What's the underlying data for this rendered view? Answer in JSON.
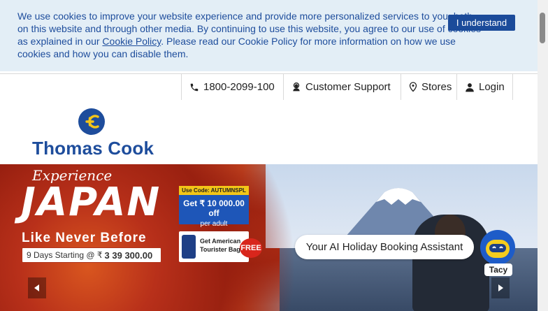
{
  "cookie_banner": {
    "text_before": "We use cookies to improve your website experience and provide more personalized services to you, both on this website and through other media. By continuing to use this website, you agree to our use of cookies as explained in our ",
    "policy_link": "Cookie Policy",
    "text_after": ". Please read our Cookie Policy for more information on how we use cookies and how you can disable them.",
    "button_label": "I understand"
  },
  "topbar": {
    "phone": "1800-2099-100",
    "support": "Customer Support",
    "stores": "Stores",
    "login": "Login"
  },
  "brand": {
    "name": "Thomas Cook",
    "logo_color": "#1e4d9c"
  },
  "hero": {
    "kicker": "Experience",
    "title": "JAPAN",
    "tagline": "Like Never Before",
    "days_text": "9 Days Starting @ ₹",
    "price": "3 39 300.00",
    "promo_code_label": "Use Code: AUTUMNSPL",
    "offer_line1": "Get ₹ 10 000.00 off",
    "offer_line2": "per adult",
    "bag_line1": "Get American",
    "bag_line2": "Tourister Bag",
    "free_badge": "FREE"
  },
  "assistant": {
    "bubble_text": "Your AI Holiday Booking Assistant",
    "name": "Tacy"
  },
  "icons": {
    "phone": "phone-icon",
    "support": "support-agent-icon",
    "stores": "location-pin-icon",
    "login": "user-icon",
    "prev": "chevron-left-icon",
    "next": "chevron-right-icon"
  }
}
